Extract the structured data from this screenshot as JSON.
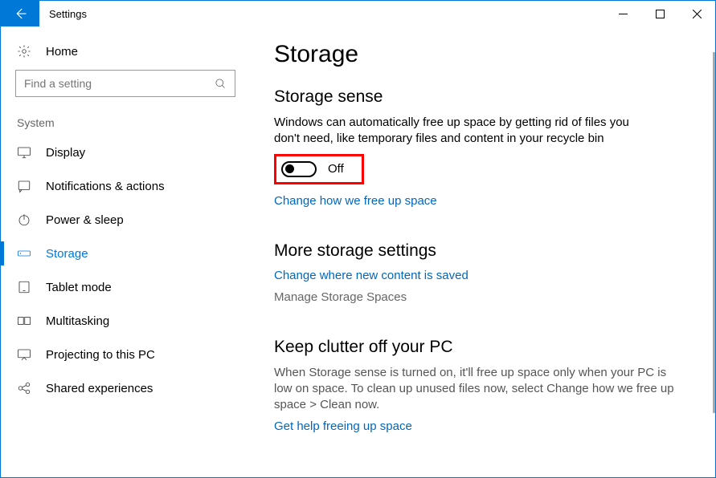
{
  "window": {
    "title": "Settings"
  },
  "sidebar": {
    "home": "Home",
    "search_placeholder": "Find a setting",
    "group": "System",
    "items": [
      {
        "label": "Display"
      },
      {
        "label": "Notifications & actions"
      },
      {
        "label": "Power & sleep"
      },
      {
        "label": "Storage"
      },
      {
        "label": "Tablet mode"
      },
      {
        "label": "Multitasking"
      },
      {
        "label": "Projecting to this PC"
      },
      {
        "label": "Shared experiences"
      }
    ]
  },
  "main": {
    "heading": "Storage",
    "storage_sense": {
      "title": "Storage sense",
      "desc": "Windows can automatically free up space by getting rid of files you don't need, like temporary files and content in your recycle bin",
      "toggle_state": "Off",
      "link": "Change how we free up space"
    },
    "more_settings": {
      "title": "More storage settings",
      "link1": "Change where new content is saved",
      "link2": "Manage Storage Spaces"
    },
    "clutter": {
      "title": "Keep clutter off your PC",
      "desc": "When Storage sense is turned on, it'll free up space only when your PC is low on space. To clean up unused files now, select Change how we free up space > Clean now.",
      "link": "Get help freeing up space"
    }
  }
}
